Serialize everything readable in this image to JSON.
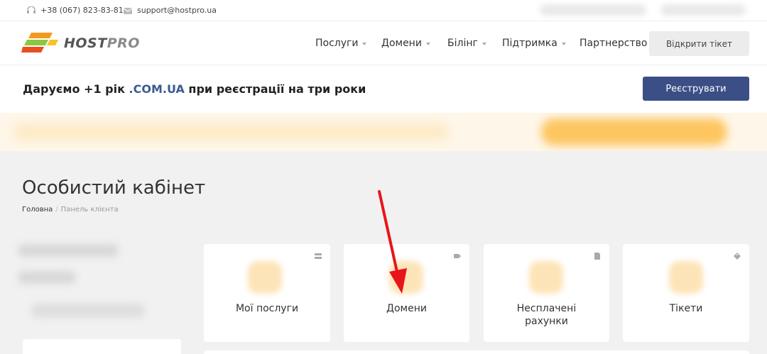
{
  "topbar": {
    "phone": "+38 (067) 823-83-81",
    "email": "support@hostpro.ua"
  },
  "logo": {
    "host": "HOST",
    "pro": "PRO"
  },
  "nav": {
    "items": [
      {
        "label": "Послуги",
        "dropdown": true
      },
      {
        "label": "Домени",
        "dropdown": true
      },
      {
        "label": "Білінг",
        "dropdown": true
      },
      {
        "label": "Підтримка",
        "dropdown": true
      },
      {
        "label": "Партнерство",
        "dropdown": false
      }
    ],
    "ticket_button": "Відкрити тікет"
  },
  "promo": {
    "text_before": "Даруємо +1 рік ",
    "highlight": ".COM.UA",
    "text_after": " при реєстрації на три роки",
    "button": "Реєструвати"
  },
  "page": {
    "title": "Особистий кабінет",
    "breadcrumb": {
      "home": "Головна",
      "separator": "/",
      "current": "Панель клієнта"
    }
  },
  "tiles": [
    {
      "label": "Мої послуги",
      "icon": "server-icon"
    },
    {
      "label": "Домени",
      "icon": "tag-icon"
    },
    {
      "label": "Несплачені рахунки",
      "icon": "document-icon"
    },
    {
      "label": "Тікети",
      "icon": "ticket-icon"
    }
  ],
  "colors": {
    "accent_blue": "#3b4f86",
    "highlight_blue": "#3b5b92",
    "annotation_red": "#e8141a",
    "banner_yellow": "#fdc660"
  }
}
